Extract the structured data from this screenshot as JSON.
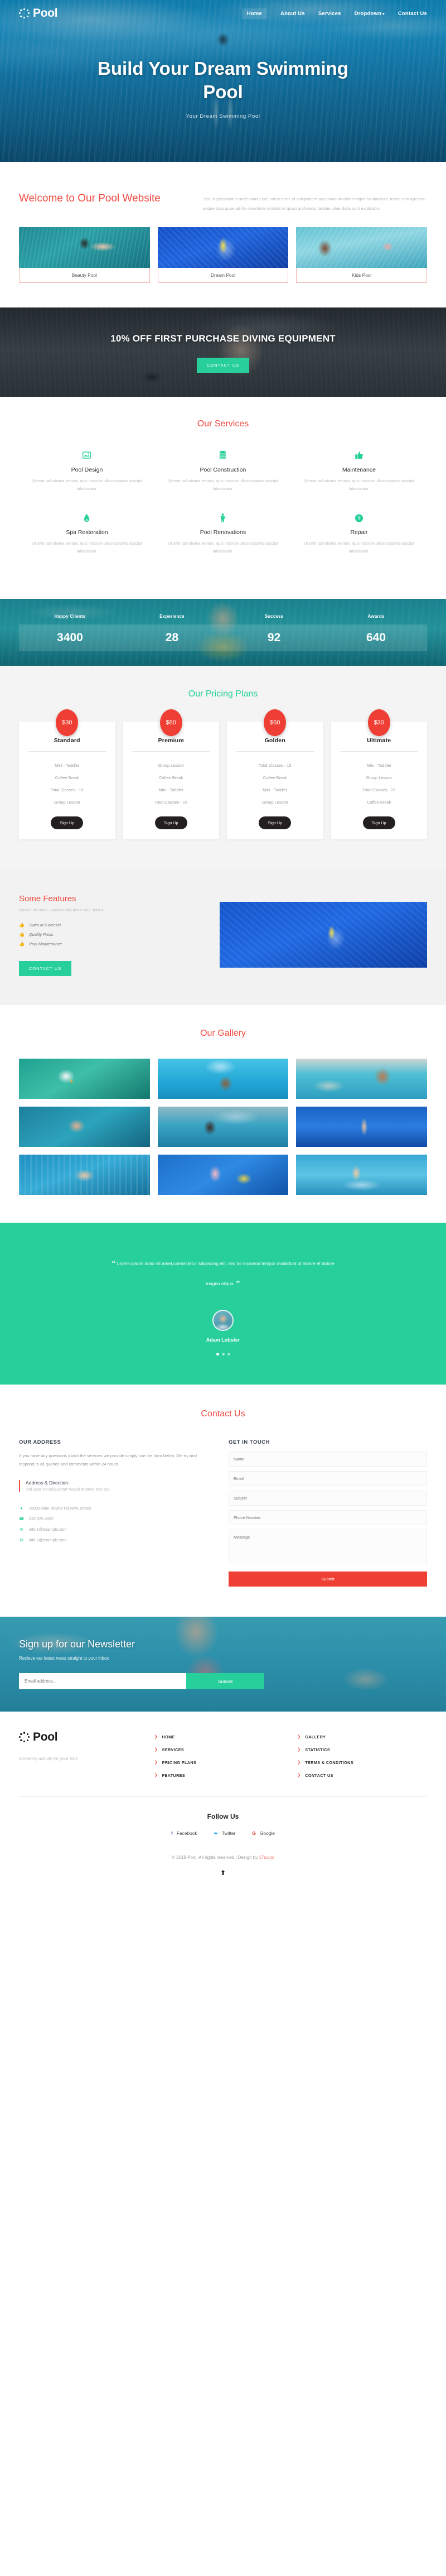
{
  "brand": {
    "name": "Pool",
    "mark_icon": "dotted-circle-icon"
  },
  "nav": {
    "items": [
      {
        "label": "Home",
        "active": true
      },
      {
        "label": "About Us",
        "active": false
      },
      {
        "label": "Services",
        "active": false
      },
      {
        "label": "Dropdown",
        "active": false,
        "caret": "⌄"
      },
      {
        "label": "Contact Us",
        "active": false
      }
    ]
  },
  "hero": {
    "title": "Build Your Dream Swimming Pool",
    "subtitle": "Your Dream Swimming Pool"
  },
  "welcome": {
    "title": "Welcome to Our Pool Website",
    "paragraph": "Sed ut perspiciatis unde omnis iste natus error sit voluptatem accusantium doloremque laudantium, totam rem aperiam, eaque ipsa quae ab illo inventore veritatis et quasi architecto beatae vitae dicta sunt explicabo.",
    "cards": [
      {
        "caption": "Beauty Pool"
      },
      {
        "caption": "Dream Pool"
      },
      {
        "caption": "Kids Pool"
      }
    ]
  },
  "promo": {
    "title": "10% OFF FIRST PURCHASE DIVING EQUIPMENT",
    "button": "CONTACT US"
  },
  "services": {
    "title": "Our Services",
    "items": [
      {
        "name": "Pool Design",
        "desc": "Ut enim ad minima veniam, quis nostrum ullam corporis suscipit laboriosam.",
        "icon": "image-icon"
      },
      {
        "name": "Pool Construction",
        "desc": "Ut enim ad minima veniam, quis nostrum ullam corporis suscipit laboriosam.",
        "icon": "database-icon"
      },
      {
        "name": "Maintenance",
        "desc": "Ut enim ad minima veniam, quis nostrum ullam corporis suscipit laboriosam.",
        "icon": "thumbs-up-icon"
      },
      {
        "name": "Spa Restoration",
        "desc": "Ut enim ad minima veniam, quis nostrum ullam corporis suscipit laboriosam.",
        "icon": "water-drop-icon"
      },
      {
        "name": "Pool Renovations",
        "desc": "Ut enim ad minima veniam, quis nostrum ullam corporis suscipit laboriosam.",
        "icon": "person-icon"
      },
      {
        "name": "Repair",
        "desc": "Ut enim ad minima veniam, quis nostrum ullam corporis suscipit laboriosam.",
        "icon": "question-circle-icon"
      }
    ]
  },
  "counters": [
    {
      "label": "Happy Clients",
      "value": "3400"
    },
    {
      "label": "Experience",
      "value": "28"
    },
    {
      "label": "Success",
      "value": "92"
    },
    {
      "label": "Awards",
      "value": "640"
    }
  ],
  "pricing": {
    "title": "Our Pricing Plans",
    "plans": [
      {
        "price": "$30",
        "name": "Standard",
        "features": [
          "Mini - Toddler",
          "Coffee Break",
          "Total Classes - 15",
          "Group Lesson"
        ],
        "button": "Sign Up"
      },
      {
        "price": "$80",
        "name": "Premium",
        "features": [
          "Group Lesson",
          "Coffee Break",
          "Mini - Toddler",
          "Total Classes - 15"
        ],
        "button": "Sign Up"
      },
      {
        "price": "$60",
        "name": "Golden",
        "features": [
          "Total Classes - 15",
          "Coffee Break",
          "Mini - Toddler",
          "Group Lesson"
        ],
        "button": "Sign Up"
      },
      {
        "price": "$30",
        "name": "Ultimate",
        "features": [
          "Mini - Toddler",
          "Group Lesson",
          "Total Classes - 15",
          "Coffee Break"
        ],
        "button": "Sign Up"
      }
    ]
  },
  "features": {
    "title": "Some Features",
    "subtitle": "Donec mi nulla, aucto nulla auctr nec sem a.",
    "items": [
      {
        "label": "Swim in 6 weeks!",
        "icon": "thumbs-up-icon"
      },
      {
        "label": "Quality Pools",
        "icon": "thumbs-up-icon"
      },
      {
        "label": "Pool Maintenance",
        "icon": "thumbs-up-icon"
      }
    ],
    "button": "CONTACT US"
  },
  "gallery": {
    "title": "Our Gallery",
    "count": 9
  },
  "testimonial": {
    "quote": "Lorem ipsum dolor sit amet,consectetur adipiscing elit, sed do eiusmod tempor incididunt ut labore et dolore magna aliqua.",
    "open_quote": "“",
    "close_quote": "”",
    "name": "Adam Lobster"
  },
  "contact": {
    "title": "Contact Us",
    "address": {
      "heading": "OUR ADDRESS",
      "paragraph": "If you have any questions about the services we provide simply use the form below. We try and respond to all queries and comments within 24 hours.",
      "direction_title": "Address & Direction:",
      "direction_sub": "sed quia consequuntur magni dolores eos qui",
      "items": [
        {
          "icon": "map-pin-icon",
          "text": "25095 Blue Ravine Rd,New Jersey"
        },
        {
          "icon": "phone-icon",
          "text": "032 625 4592"
        },
        {
          "icon": "envelope-icon",
          "text": "info 1@example.com"
        },
        {
          "icon": "envelope-icon",
          "text": "info 2@example.com"
        }
      ]
    },
    "form": {
      "heading": "GET IN TOUCH",
      "name_placeholder": "Name",
      "email_placeholder": "Email",
      "subject_placeholder": "Subject",
      "phone_placeholder": "Phone Number",
      "message_placeholder": "Message",
      "submit": "Submit"
    }
  },
  "newsletter": {
    "title": "Sign up for our Newsletter",
    "subtitle": "Recieve our latest news straight to your inbox",
    "placeholder": "Email address...",
    "button": "Submit"
  },
  "footer": {
    "brand": "Pool",
    "tagline": "A healthy activity for your kids",
    "links_col1": [
      "HOME",
      "SERVICES",
      "PRICING PLANS",
      "FEATURES"
    ],
    "links_col2": [
      "GALLERY",
      "STATISTICS",
      "TERMS & CONDITIONS",
      "CONTACT US"
    ],
    "follow_title": "Follow Us",
    "socials": [
      {
        "name": "Facebook",
        "glyph": "f",
        "color": "#3b5998"
      },
      {
        "name": "Twitter",
        "glyph": "❧",
        "color": "#1da1f2"
      },
      {
        "name": "Google",
        "glyph": "G",
        "color": "#db4437"
      }
    ],
    "copyright_prefix": "© 2018 Pool. All rights reserved | Design by ",
    "copyright_link": "17sucai",
    "to_top_icon": "arrow-up-icon"
  },
  "colors": {
    "red": "#f04b41",
    "teal": "#27cf9b",
    "dark": "#231f20"
  }
}
